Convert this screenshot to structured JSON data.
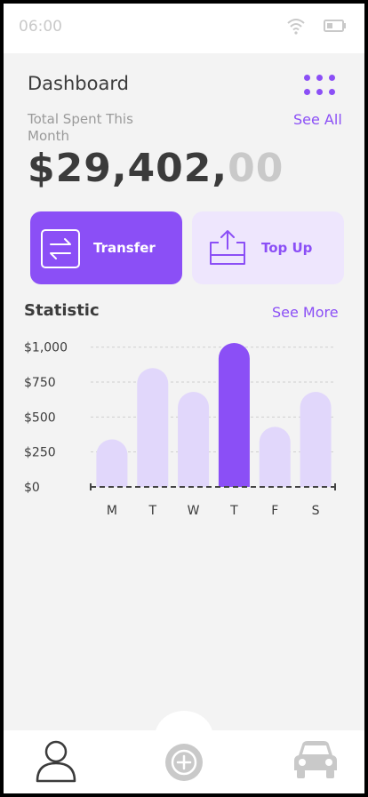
{
  "status": {
    "time": "06:00",
    "wifi_icon": "wifi-icon",
    "battery_icon": "battery-icon"
  },
  "header": {
    "title": "Dashboard",
    "menu_icon": "dots-grid-icon"
  },
  "summary": {
    "label": "Total Spent This Month",
    "see_all": "See All",
    "amount_main": "$29,402,",
    "amount_cents": "00"
  },
  "actions": [
    {
      "label": "Transfer",
      "icon": "transfer-arrows-icon"
    },
    {
      "label": "Top Up",
      "icon": "upload-tray-icon"
    }
  ],
  "statistic": {
    "title": "Statistic",
    "see_more": "See More"
  },
  "chart_data": {
    "type": "bar",
    "categories": [
      "M",
      "T",
      "W",
      "T",
      "F",
      "S"
    ],
    "values": [
      340,
      850,
      680,
      1030,
      430,
      680
    ],
    "highlight_index": 3,
    "yticks": [
      "$0",
      "$250",
      "$500",
      "$750",
      "$1,000"
    ],
    "ytick_values": [
      0,
      250,
      500,
      750,
      1000
    ],
    "ylim": [
      0,
      1030
    ],
    "grid": true,
    "colors": {
      "bar": "#e1d7fb",
      "highlight": "#8b4ff6",
      "axis": "#444444",
      "grid": "#cfcfcf"
    }
  },
  "nav": [
    {
      "icon": "user-icon"
    },
    {
      "icon": "plus-circle-icon"
    },
    {
      "icon": "car-icon"
    }
  ],
  "colors": {
    "accent": "#8b4ff6",
    "accent_light": "#eee6fd",
    "background": "#f3f3f3"
  }
}
